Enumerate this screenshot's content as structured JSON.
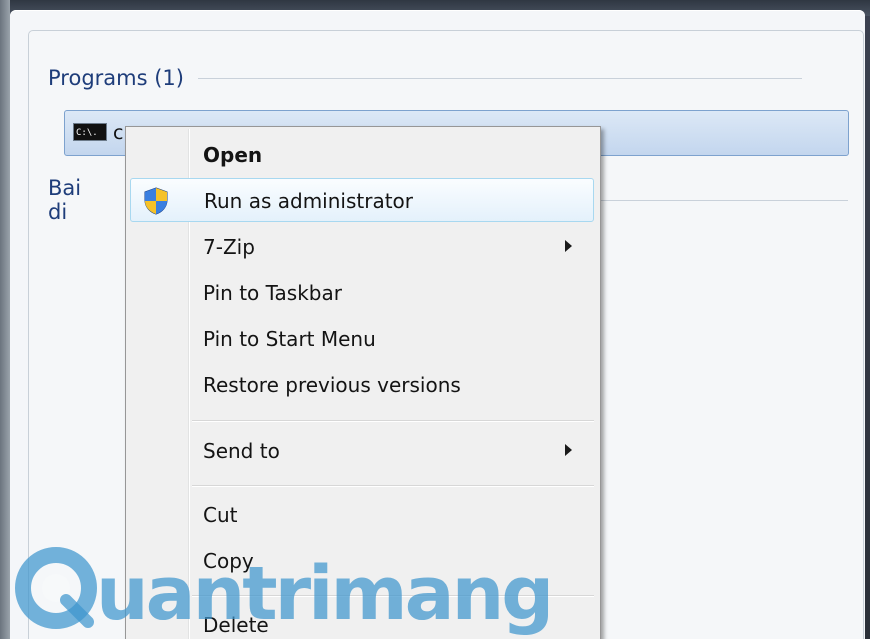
{
  "start_menu": {
    "programs_header": "Programs (1)",
    "second_header": "Bai di",
    "result": {
      "icon": "cmd-icon",
      "icon_text": "C:\\.",
      "label": "c"
    }
  },
  "context_menu": {
    "items": [
      {
        "label": "Open",
        "bold": true
      },
      {
        "label": "Run as administrator",
        "icon": "uac-shield-icon",
        "highlighted": true
      },
      {
        "label": "7-Zip",
        "submenu": true
      },
      {
        "label": "Pin to Taskbar"
      },
      {
        "label": "Pin to Start Menu"
      },
      {
        "label": "Restore previous versions"
      },
      {
        "label": "Send to",
        "submenu": true
      },
      {
        "label": "Cut"
      },
      {
        "label": "Copy"
      },
      {
        "label": "Delete"
      }
    ]
  },
  "watermark": {
    "text": "uantrimang"
  },
  "colors": {
    "header_text": "#1e3d7a",
    "highlight_border": "#a8d8f0",
    "watermark": "#3e96cd"
  }
}
